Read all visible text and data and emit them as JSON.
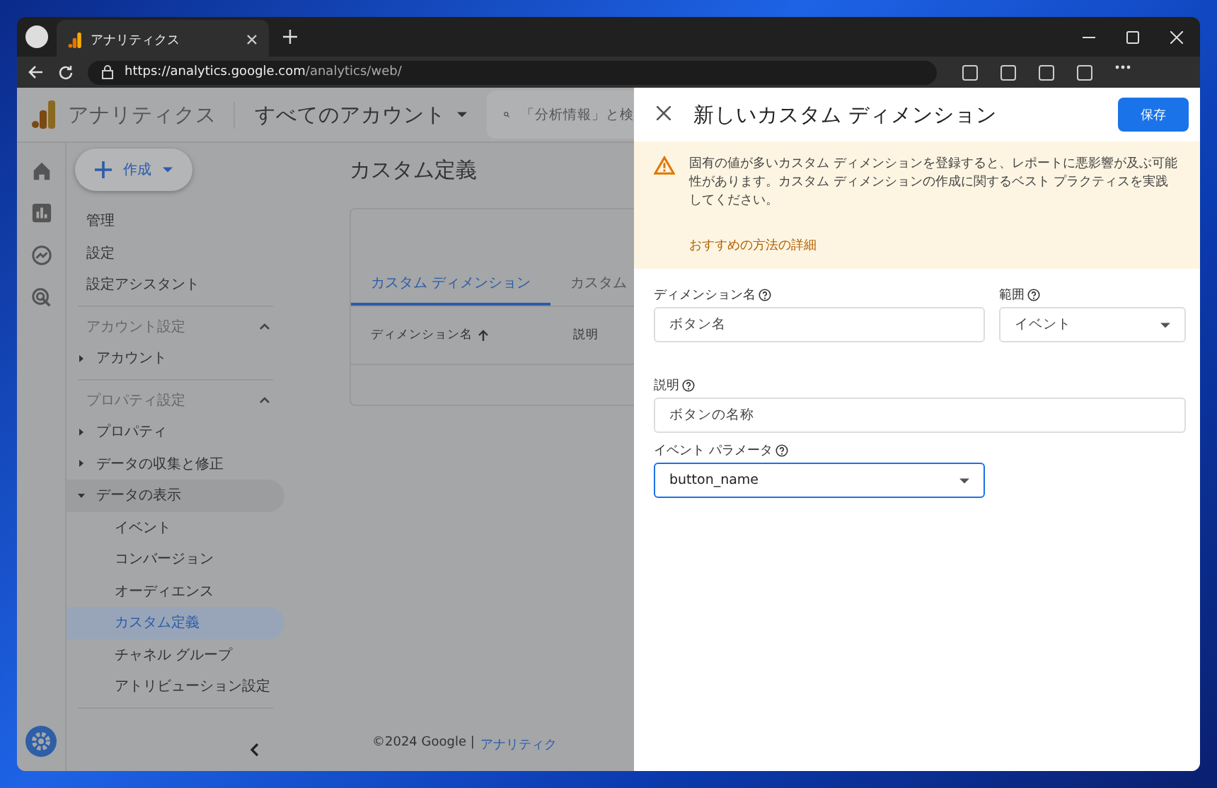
{
  "browser": {
    "tab_title": "アナリティクス",
    "url_host": "https://analytics.google.com",
    "url_path": "/analytics/web/"
  },
  "app": {
    "title": "アナリティクス",
    "account": "すべてのアカウント",
    "search_placeholder": "「分析情報」と検"
  },
  "sidebar": {
    "create_button": "作成",
    "items": [
      {
        "kind": "link",
        "label": "管理",
        "selected": false
      },
      {
        "kind": "link",
        "label": "設定",
        "selected": false
      },
      {
        "kind": "link",
        "label": "設定アシスタント",
        "selected": false
      },
      {
        "kind": "section",
        "label": "アカウント設定",
        "expanded": true,
        "children": [
          {
            "kind": "node",
            "label": "アカウント",
            "expanded": false,
            "selected": false
          }
        ]
      },
      {
        "kind": "section",
        "label": "プロパティ設定",
        "expanded": true,
        "children": [
          {
            "kind": "node",
            "label": "プロパティ",
            "expanded": false,
            "selected": false
          },
          {
            "kind": "node",
            "label": "データの収集と修正",
            "expanded": false,
            "selected": false
          },
          {
            "kind": "node",
            "label": "データの表示",
            "expanded": true,
            "selected": false,
            "children": [
              {
                "kind": "leaf",
                "label": "イベント",
                "selected": false
              },
              {
                "kind": "leaf",
                "label": "コンバージョン",
                "selected": false
              },
              {
                "kind": "leaf",
                "label": "オーディエンス",
                "selected": false
              },
              {
                "kind": "leaf",
                "label": "カスタム定義",
                "selected": true
              },
              {
                "kind": "leaf",
                "label": "チャネル グループ",
                "selected": false
              },
              {
                "kind": "leaf",
                "label": "アトリビューション設定",
                "selected": false
              }
            ]
          }
        ]
      }
    ]
  },
  "main": {
    "title": "カスタム定義",
    "tabs": [
      {
        "label": "カスタム ディメンション",
        "selected": true
      },
      {
        "label": "カスタム",
        "selected": false
      }
    ],
    "columns": [
      "ディメンション名",
      "説明"
    ],
    "footer_copyright": "©2024 Google |",
    "footer_link": "アナリティク"
  },
  "drawer": {
    "title": "新しいカスタム ディメンション",
    "save_button": "保存",
    "warning": "固有の値が多いカスタム ディメンションを登録すると、レポートに悪影響が及ぶ可能性があります。カスタム ディメンションの作成に関するベスト プラクティスを実践してください。",
    "warning_link": "おすすめの方法の詳細",
    "fields": [
      {
        "kind": "text",
        "label": "ディメンション名",
        "value": "ボタン名",
        "focused": false
      },
      {
        "kind": "select",
        "label": "範囲",
        "value": "イベント",
        "focused": false
      },
      {
        "kind": "text",
        "label": "説明",
        "value": "ボタンの名称",
        "focused": false
      },
      {
        "kind": "select",
        "label": "イベント パラメータ",
        "value": "button_name",
        "focused": true
      }
    ]
  }
}
